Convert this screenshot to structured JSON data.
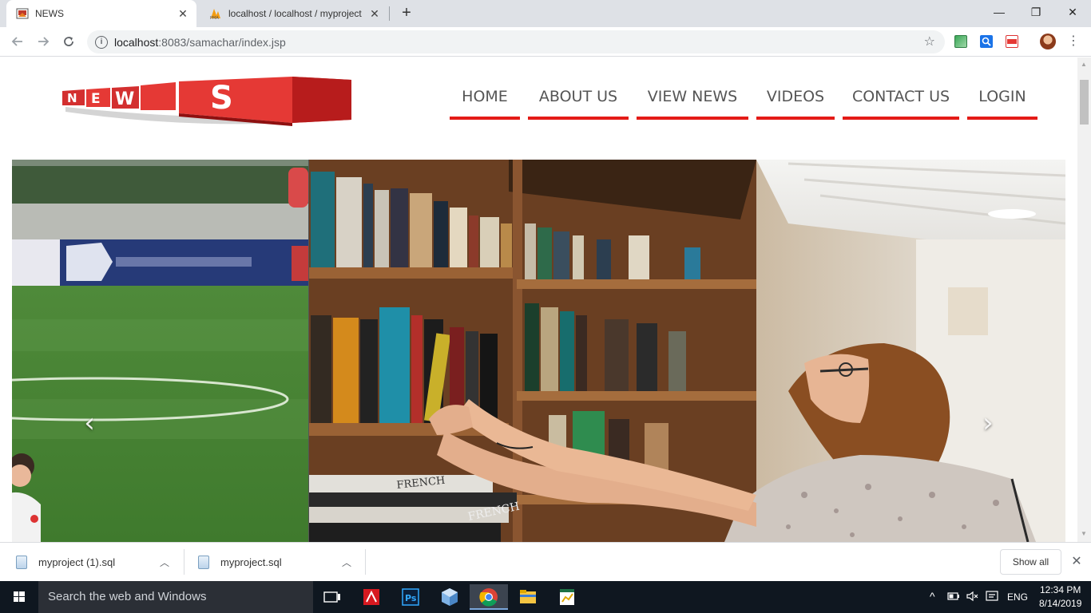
{
  "browser": {
    "tabs": [
      {
        "title": "NEWS",
        "active": true,
        "icon": "news-favicon"
      },
      {
        "title": "localhost / localhost / myproject",
        "active": false,
        "icon": "phpmyadmin-favicon"
      }
    ],
    "new_tab_symbol": "+",
    "window_controls": {
      "minimize": "—",
      "maximize": "❐",
      "close": "✕"
    },
    "address": {
      "host": "localhost",
      "rest": ":8083/samachar/index.jsp"
    },
    "icons": {
      "back": "arrow-left-icon",
      "forward": "arrow-right-icon",
      "reload": "reload-icon",
      "info": "info-icon",
      "bookmark": "star-icon",
      "menu": "three-dots-icon"
    }
  },
  "site": {
    "logo_text": "NEWS",
    "nav": [
      {
        "label": "HOME"
      },
      {
        "label": "ABOUT US"
      },
      {
        "label": "VIEW NEWS"
      },
      {
        "label": "VIDEOS"
      },
      {
        "label": "CONTACT US"
      },
      {
        "label": "LOGIN"
      }
    ],
    "accent_color": "#e41b17",
    "carousel": {
      "prev_symbol": "‹",
      "next_symbol": "›",
      "slides": [
        {
          "scene": "football-field"
        },
        {
          "scene": "woman-at-bookshelf"
        }
      ]
    }
  },
  "downloads": {
    "items": [
      {
        "filename": "myproject (1).sql"
      },
      {
        "filename": "myproject.sql"
      }
    ],
    "show_all_label": "Show all"
  },
  "taskbar": {
    "search_placeholder": "Search the web and Windows",
    "language": "ENG",
    "time": "12:34 PM",
    "date": "8/14/2019",
    "apps": [
      "task-view-icon",
      "adobe-acrobat-icon",
      "photoshop-icon",
      "3d-box-icon",
      "chrome-icon",
      "file-explorer-icon",
      "spreadsheet-icon"
    ]
  }
}
